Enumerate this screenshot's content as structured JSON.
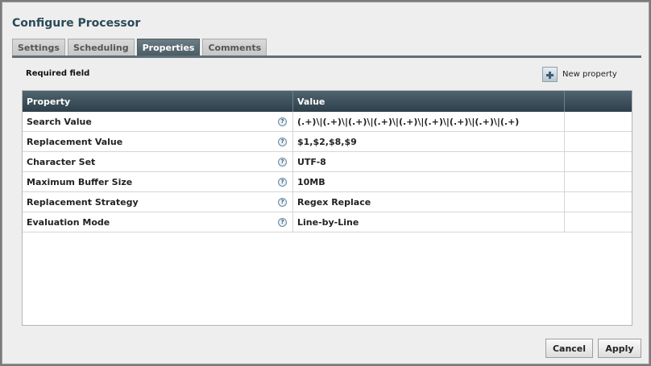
{
  "dialog": {
    "title": "Configure Processor"
  },
  "tabs": [
    {
      "label": "Settings",
      "active": false
    },
    {
      "label": "Scheduling",
      "active": false
    },
    {
      "label": "Properties",
      "active": true
    },
    {
      "label": "Comments",
      "active": false
    }
  ],
  "properties_panel": {
    "required_label": "Required field",
    "new_property_label": "New property",
    "columns": [
      "Property",
      "Value"
    ],
    "rows": [
      {
        "property": "Search Value",
        "value": "(.+)\\|(.+)\\|(.+)\\|(.+)\\|(.+)\\|(.+)\\|(.+)\\|(.+)\\|(.+)"
      },
      {
        "property": "Replacement Value",
        "value": "$1,$2,$8,$9"
      },
      {
        "property": "Character Set",
        "value": "UTF-8"
      },
      {
        "property": "Maximum Buffer Size",
        "value": "10MB"
      },
      {
        "property": "Replacement Strategy",
        "value": "Regex Replace"
      },
      {
        "property": "Evaluation Mode",
        "value": "Line-by-Line"
      }
    ],
    "help_icon": "question-circle-icon",
    "help_glyph": "?"
  },
  "buttons": {
    "cancel": "Cancel",
    "apply": "Apply"
  }
}
